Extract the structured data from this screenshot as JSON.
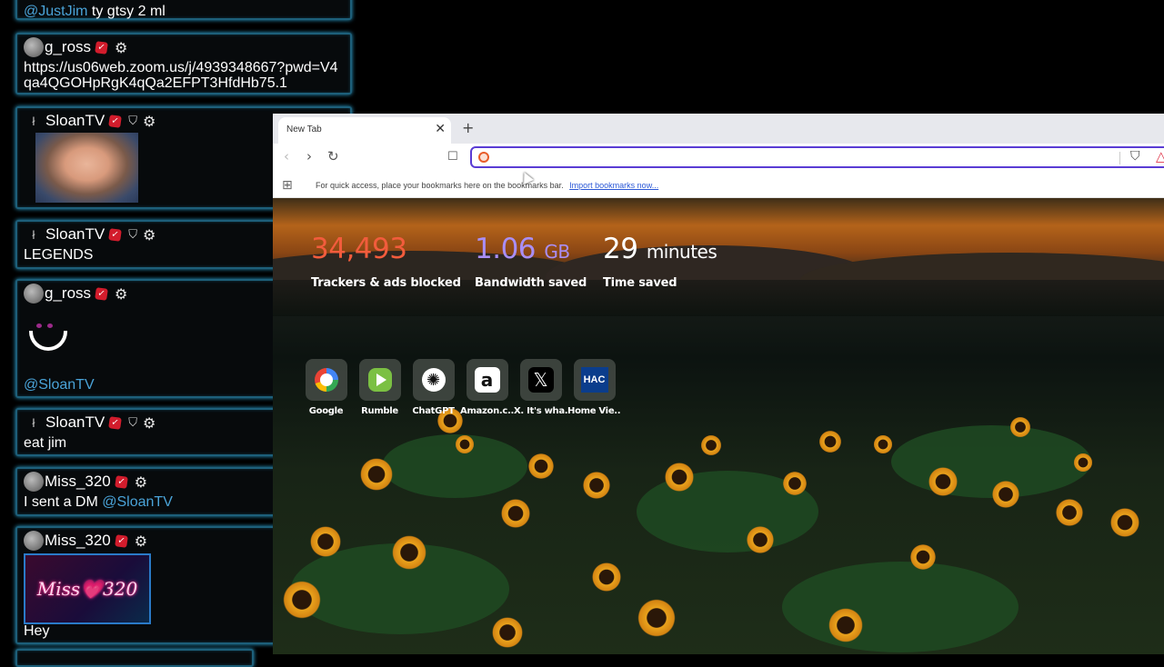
{
  "chat": {
    "messages": [
      {
        "mention": "@JustJim",
        "text": " ty gtsy 2 ml"
      },
      {
        "user": "g_ross",
        "text": "https://us06web.zoom.us/j/4939348667?pwd=V4qa4QGOHpRgK4qQa2EFPT3HfdHb75.1"
      },
      {
        "user": "SloanTV"
      },
      {
        "user": "SloanTV",
        "text": "LEGENDS"
      },
      {
        "user": "g_ross",
        "mention": "@SloanTV"
      },
      {
        "user": "SloanTV",
        "text": "eat jim"
      },
      {
        "user": "Miss_320",
        "text": "I sent a DM ",
        "mention": "@SloanTV"
      },
      {
        "user": "Miss_320",
        "image_text": "Miss💗320",
        "text": "Hey"
      }
    ]
  },
  "browser": {
    "tab_title": "New Tab",
    "url_value": "",
    "bookmarks_hint": "For quick access, place your bookmarks here on the bookmarks bar.",
    "import_link": "Import bookmarks now...",
    "accent_color": "#5a3cd4"
  },
  "ntp": {
    "stats": [
      {
        "value": "34,493",
        "unit": "",
        "label": "Trackers & ads blocked",
        "color": "#f25c3c"
      },
      {
        "value": "1.06",
        "unit": "GB",
        "label": "Bandwidth saved",
        "color": "#a98ef5"
      },
      {
        "value": "29",
        "unit": "minutes",
        "label": "Time saved",
        "color": "#ffffff"
      }
    ],
    "tiles": [
      {
        "label": "Google",
        "icon": "google-icon"
      },
      {
        "label": "Rumble",
        "icon": "rumble-icon"
      },
      {
        "label": "ChatGPT",
        "icon": "chatgpt-icon"
      },
      {
        "label": "Amazon.c...",
        "icon": "amazon-icon"
      },
      {
        "label": "X. It's wha...",
        "icon": "x-icon"
      },
      {
        "label": "Home Vie...",
        "icon": "hac-icon",
        "icon_text": "HAC"
      }
    ]
  }
}
